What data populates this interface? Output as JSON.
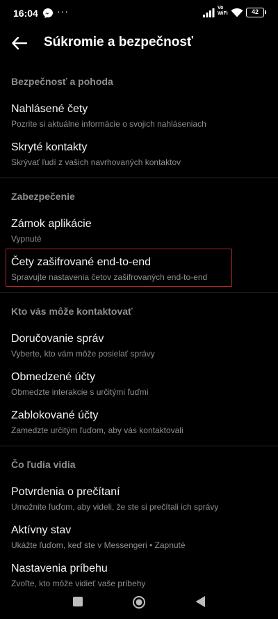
{
  "status_bar": {
    "time": "16:04",
    "more": "···",
    "vowifi_top": "Vo",
    "vowifi_bottom": "WiFi",
    "battery": "42"
  },
  "header": {
    "title": "Súkromie a bezpečnosť"
  },
  "sections": [
    {
      "title": "Bezpečnosť a pohoda",
      "items": [
        {
          "title": "Nahlásené čety",
          "subtitle": "Pozrite si aktuálne informácie o svojich nahláseniach"
        },
        {
          "title": "Skryté kontakty",
          "subtitle": "Skrývať ľudí z vašich navrhovaných kontaktov"
        }
      ]
    },
    {
      "title": "Zabezpečenie",
      "items": [
        {
          "title": "Zámok aplikácie",
          "subtitle": "Vypnuté"
        },
        {
          "title": "Čety zašifrované end-to-end",
          "subtitle": "Spravujte nastavenia četov zašifrovaných end-to-end"
        }
      ]
    },
    {
      "title": "Kto vás môže kontaktovať",
      "items": [
        {
          "title": "Doručovanie správ",
          "subtitle": "Vyberte, kto vám môže posielať správy"
        },
        {
          "title": "Obmedzené účty",
          "subtitle": "Obmedzte interakcie s určitými ľuďmi"
        },
        {
          "title": "Zablokované účty",
          "subtitle": "Zamedzte určitým ľuďom, aby vás kontaktovali"
        }
      ]
    },
    {
      "title": "Čo ľudia vidia",
      "items": [
        {
          "title": "Potvrdenia o prečítaní",
          "subtitle": "Umožnite ľuďom, aby videli, že ste si prečítali ich správy"
        },
        {
          "title": "Aktívny stav",
          "subtitle": "Ukážte ľuďom, keď ste v Messengeri • Zapnuté"
        },
        {
          "title": "Nastavenia príbehu",
          "subtitle": "Zvoľte, kto môže vidieť vaše príbehy"
        }
      ]
    }
  ],
  "colors": {
    "background": "#000000",
    "primary_text": "#f2f2f2",
    "secondary_text": "#8e8e8e",
    "highlight_border": "#b5272c"
  }
}
